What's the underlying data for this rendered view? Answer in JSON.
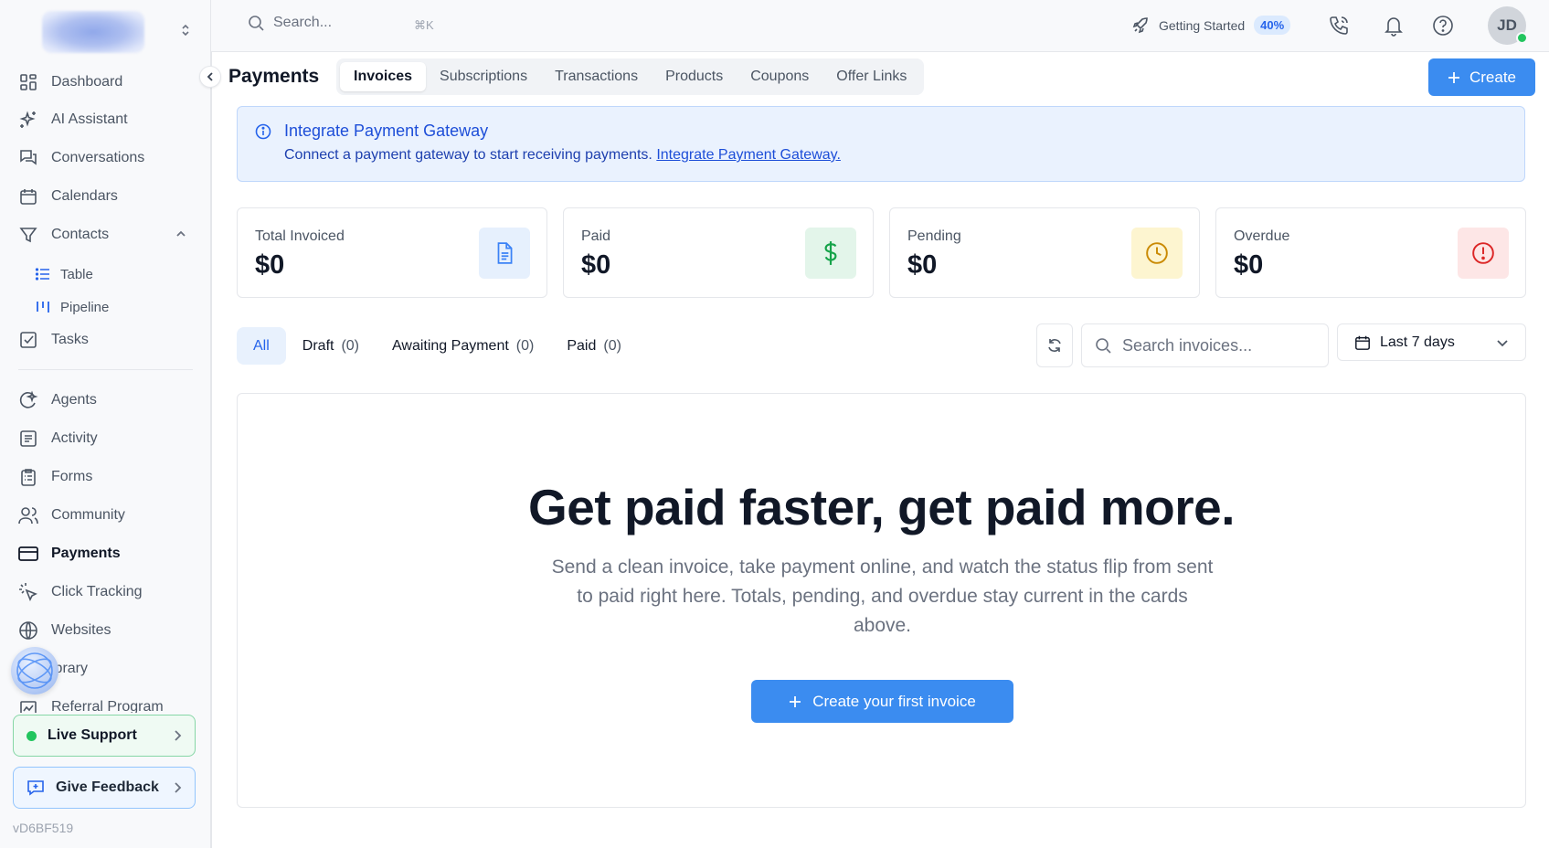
{
  "sidebar": {
    "items": [
      {
        "label": "Dashboard",
        "icon": "dashboard-icon"
      },
      {
        "label": "AI Assistant",
        "icon": "sparkles-icon"
      },
      {
        "label": "Conversations",
        "icon": "chat-icon"
      },
      {
        "label": "Calendars",
        "icon": "calendar-icon"
      },
      {
        "label": "Contacts",
        "icon": "funnel-icon"
      },
      {
        "label": "Tasks",
        "icon": "checkbox-icon"
      },
      {
        "label": "Agents",
        "icon": "agents-icon"
      },
      {
        "label": "Activity",
        "icon": "activity-icon"
      },
      {
        "label": "Forms",
        "icon": "clipboard-icon"
      },
      {
        "label": "Community",
        "icon": "users-icon"
      },
      {
        "label": "Payments",
        "icon": "credit-card-icon"
      },
      {
        "label": "Click Tracking",
        "icon": "cursor-click-icon"
      },
      {
        "label": "Websites",
        "icon": "globe-icon"
      },
      {
        "label": "ibrary",
        "icon": "library-icon"
      },
      {
        "label": "Referral Program",
        "icon": "referral-icon"
      }
    ],
    "contacts_sub": [
      {
        "label": "Table"
      },
      {
        "label": "Pipeline"
      }
    ],
    "support_label": "Live Support",
    "feedback_label": "Give Feedback",
    "version": "vD6BF519"
  },
  "topbar": {
    "search_placeholder": "Search...",
    "shortcut": "⌘K",
    "getting_started": "Getting Started",
    "progress": "40%",
    "avatar_initials": "JD"
  },
  "page": {
    "title": "Payments",
    "tabs": [
      "Invoices",
      "Subscriptions",
      "Transactions",
      "Products",
      "Coupons",
      "Offer Links"
    ],
    "active_tab": "Invoices",
    "create_label": "Create"
  },
  "banner": {
    "title": "Integrate Payment Gateway",
    "text": "Connect a payment gateway to start receiving payments.",
    "link": "Integrate Payment Gateway."
  },
  "stats": [
    {
      "label": "Total Invoiced",
      "value": "$0",
      "color": "#3b82f6",
      "bg": "#e6f0fd"
    },
    {
      "label": "Paid",
      "value": "$0",
      "color": "#16a34a",
      "bg": "#e3f5ea"
    },
    {
      "label": "Pending",
      "value": "$0",
      "color": "#ca8a04",
      "bg": "#fdf5d0"
    },
    {
      "label": "Overdue",
      "value": "$0",
      "color": "#dc2626",
      "bg": "#fde6e6"
    }
  ],
  "filters": [
    {
      "label": "All",
      "count": ""
    },
    {
      "label": "Draft",
      "count": "(0)"
    },
    {
      "label": "Awaiting Payment",
      "count": "(0)"
    },
    {
      "label": "Paid",
      "count": "(0)"
    }
  ],
  "invoice_search_placeholder": "Search invoices...",
  "date_range": "Last 7 days",
  "empty_state": {
    "heading": "Get paid faster, get paid more.",
    "body": "Send a clean invoice, take payment online, and watch the status flip from sent to paid right here. Totals, pending, and overdue stay current in the cards above.",
    "button": "Create your first invoice"
  },
  "colors": {
    "accent": "#3b8cf0",
    "banner_bg": "#eaf2fe"
  }
}
